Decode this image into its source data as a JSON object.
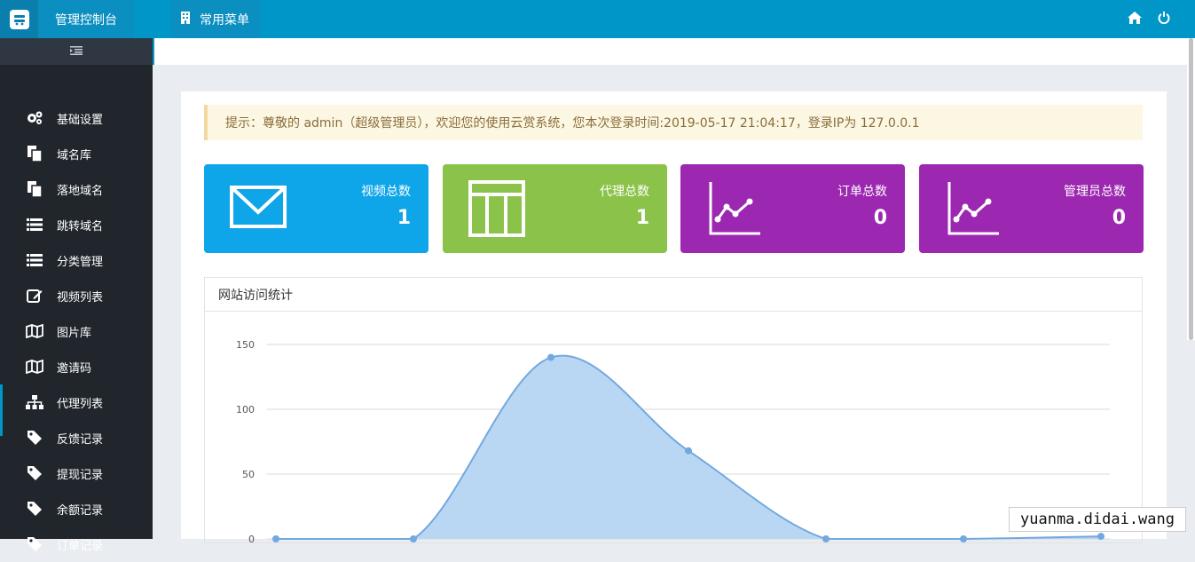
{
  "topbar": {
    "title": "管理控制台",
    "menu_label": "常用菜单",
    "icons": [
      "building-icon",
      "home-icon",
      "power-icon"
    ]
  },
  "sidebar": {
    "items": [
      {
        "label": "基础设置",
        "icon": "gears-icon"
      },
      {
        "label": "域名库",
        "icon": "copy-icon"
      },
      {
        "label": "落地域名",
        "icon": "copy-icon"
      },
      {
        "label": "跳转域名",
        "icon": "list-icon"
      },
      {
        "label": "分类管理",
        "icon": "list-icon"
      },
      {
        "label": "视频列表",
        "icon": "edit-icon"
      },
      {
        "label": "图片库",
        "icon": "map-icon"
      },
      {
        "label": "邀请码",
        "icon": "map-icon"
      },
      {
        "label": "代理列表",
        "icon": "sitemap-icon"
      },
      {
        "label": "反馈记录",
        "icon": "tag-icon"
      },
      {
        "label": "提现记录",
        "icon": "tag-icon"
      },
      {
        "label": "余额记录",
        "icon": "tag-icon"
      },
      {
        "label": "订单记录",
        "icon": "tag-icon"
      }
    ]
  },
  "notice": "提示：尊敬的 admin（超级管理员），欢迎您的使用云赏系统，您本次登录时间:2019-05-17 21:04:17，登录IP为 127.0.0.1",
  "cards": [
    {
      "label": "视频总数",
      "value": "1",
      "color": "#0ea5e9",
      "icon": "envelope-icon"
    },
    {
      "label": "代理总数",
      "value": "1",
      "color": "#8bc34a",
      "icon": "table-icon"
    },
    {
      "label": "订单总数",
      "value": "0",
      "color": "#9c27b0",
      "icon": "line-chart-icon"
    },
    {
      "label": "管理员总数",
      "value": "0",
      "color": "#9c27b0",
      "icon": "line-chart-icon"
    }
  ],
  "panel": {
    "title": "网站访问统计"
  },
  "chart_data": {
    "type": "area",
    "x": [
      1,
      2,
      3,
      4,
      5,
      6,
      7
    ],
    "values": [
      0,
      0,
      140,
      68,
      0,
      0,
      2
    ],
    "ylim": [
      0,
      150
    ],
    "yticks": [
      "0",
      "50",
      "100",
      "150"
    ],
    "grid": true,
    "fill_color": "#b9d7f2",
    "line_color": "#72a8e0"
  },
  "watermark": "yuanma.didai.wang"
}
